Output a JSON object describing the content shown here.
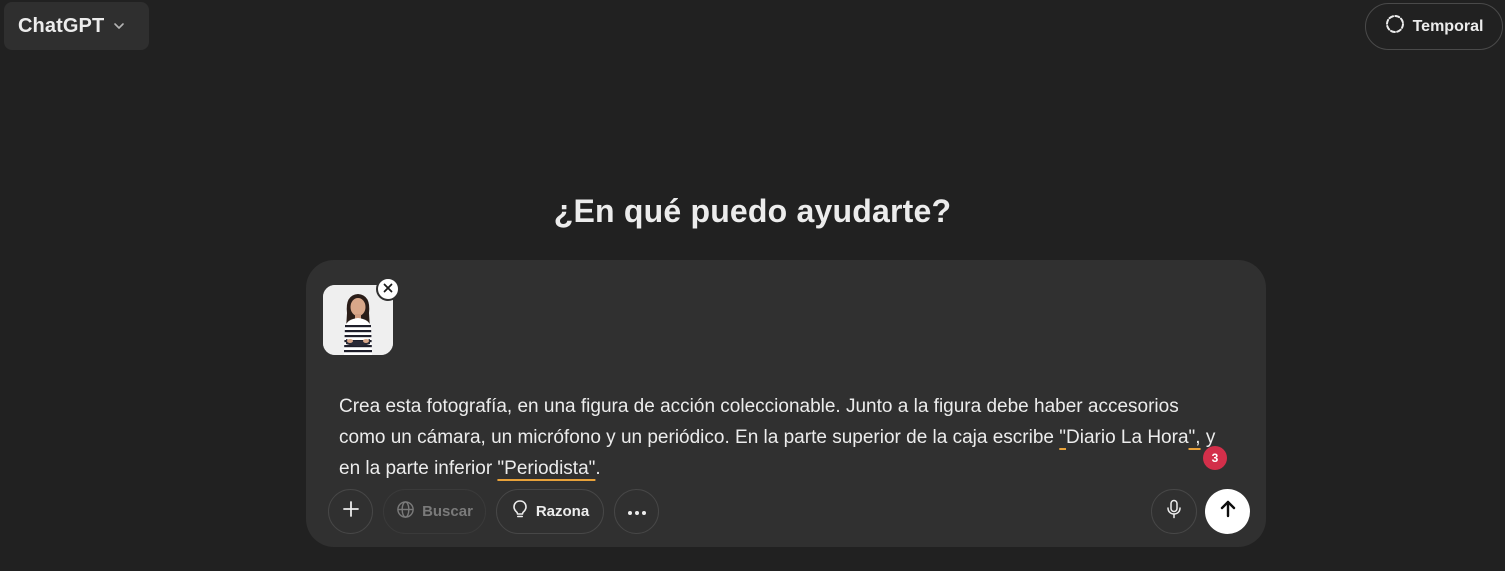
{
  "header": {
    "model_label": "ChatGPT",
    "model_chevron_icon": "chevron-down-icon",
    "temporal_label": "Temporal",
    "temporal_icon": "dashed-circle-icon"
  },
  "main": {
    "heading": "¿En qué puedo ayudarte?"
  },
  "composer": {
    "attachment": {
      "type": "image",
      "remove_icon": "close-icon"
    },
    "prompt_segments": [
      "Crea esta fotografía, en una figura de acción coleccionable. Junto a la figura debe haber accesorios como un cámara, un micrófono y un periódico. En la parte superior de la caja escribe ",
      "\"",
      "Diario La Hora",
      "\",",
      " y en la parte inferior ",
      "\"Periodista\"",
      "."
    ],
    "spellcheck_count": "3",
    "spellcheck_color": "#d32f4a",
    "toolbar": {
      "add_icon": "plus-icon",
      "search_label": "Buscar",
      "search_icon": "globe-icon",
      "reason_label": "Razona",
      "reason_icon": "lightbulb-icon",
      "more_icon": "more-horizontal-icon",
      "mic_icon": "microphone-icon",
      "send_icon": "arrow-up-icon"
    }
  }
}
